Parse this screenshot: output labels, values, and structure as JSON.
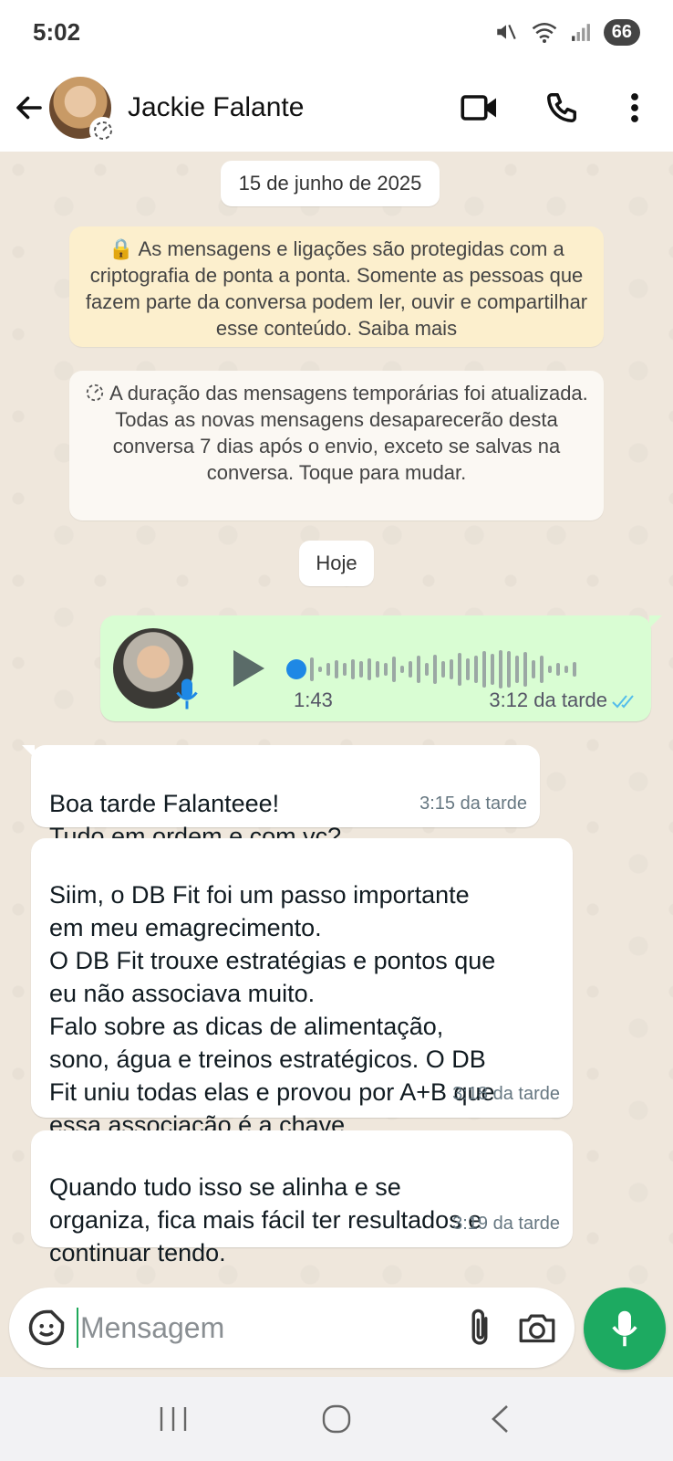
{
  "status_bar": {
    "time": "5:02",
    "battery": "66"
  },
  "header": {
    "contact_name": "Jackie Falante"
  },
  "chat": {
    "date_separator": "15 de junho de 2025",
    "encryption_notice": "🔒 As mensagens e ligações são protegidas com a criptografia de ponta a ponta. Somente as pessoas que fazem parte da conversa podem ler, ouvir e compartilhar esse conteúdo. Saiba mais",
    "timer_notice": "A duração das mensagens temporárias foi atualizada. Todas as novas mensagens desaparecerão desta conversa 7 dias após o envio, exceto se salvas na conversa. Toque para mudar.",
    "today_label": "Hoje",
    "voice_message": {
      "duration": "1:43",
      "time": "3:12 da tarde",
      "progress": 0
    },
    "messages": [
      {
        "text": "Boa tarde Falanteee!\nTudo em ordem e com vc?",
        "time": "3:15 da tarde"
      },
      {
        "text": "Siim, o DB Fit foi um passo importante\nem meu emagrecimento.\nO DB Fit trouxe estratégias e pontos que\neu não associava muito.\nFalo sobre as dicas de alimentação,\nsono, água e treinos estratégicos. O DB\nFit uniu todas elas e provou por A+B que\nessa associação é a chave.",
        "time": "3:18 da tarde"
      },
      {
        "text": "Quando tudo isso se alinha e se\norganiza, fica mais fácil ter resultados e\ncontinuar tendo.",
        "time": "3:19 da tarde"
      }
    ]
  },
  "composer": {
    "placeholder": "Mensagem"
  },
  "colors": {
    "outgoing_bubble": "#d9fdd3",
    "accent": "#1daa61",
    "encryption_bg": "#fcefcd",
    "read_ticks": "#53bdeb"
  },
  "icons": [
    "back-arrow-icon",
    "disappearing-timer-icon",
    "video-call-icon",
    "phone-icon",
    "more-options-icon",
    "play-icon",
    "mic-icon",
    "double-check-icon",
    "emoji-icon",
    "attach-icon",
    "camera-icon",
    "recent-apps-icon",
    "home-icon",
    "back-icon"
  ]
}
